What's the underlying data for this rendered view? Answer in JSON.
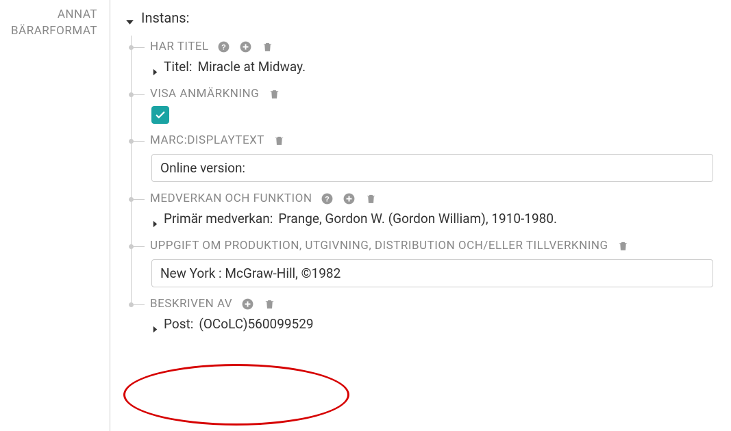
{
  "sidebar": {
    "line1": "ANNAT",
    "line2": "BÄRARFORMAT"
  },
  "section": {
    "title": "Instans:"
  },
  "fields": {
    "harTitel": {
      "label": "HAR TITEL",
      "subPrefix": "Titel:",
      "subValue": "Miracle at Midway."
    },
    "visaAnm": {
      "label": "VISA ANMÄRKNING",
      "checked": true
    },
    "displayText": {
      "label": "MARC:DISPLAYTEXT",
      "value": "Online version:"
    },
    "medverkan": {
      "label": "MEDVERKAN OCH FUNKTION",
      "subPrefix": "Primär medverkan:",
      "subValue": "Prange, Gordon W. (Gordon William), 1910-1980."
    },
    "produktion": {
      "label": "UPPGIFT OM PRODUKTION, UTGIVNING, DISTRIBUTION OCH/ELLER TILLVERKNING",
      "value": "New York : McGraw-Hill, ©1982"
    },
    "beskriven": {
      "label": "BESKRIVEN AV",
      "subPrefix": "Post:",
      "subValue": "(OCoLC)560099529"
    }
  }
}
